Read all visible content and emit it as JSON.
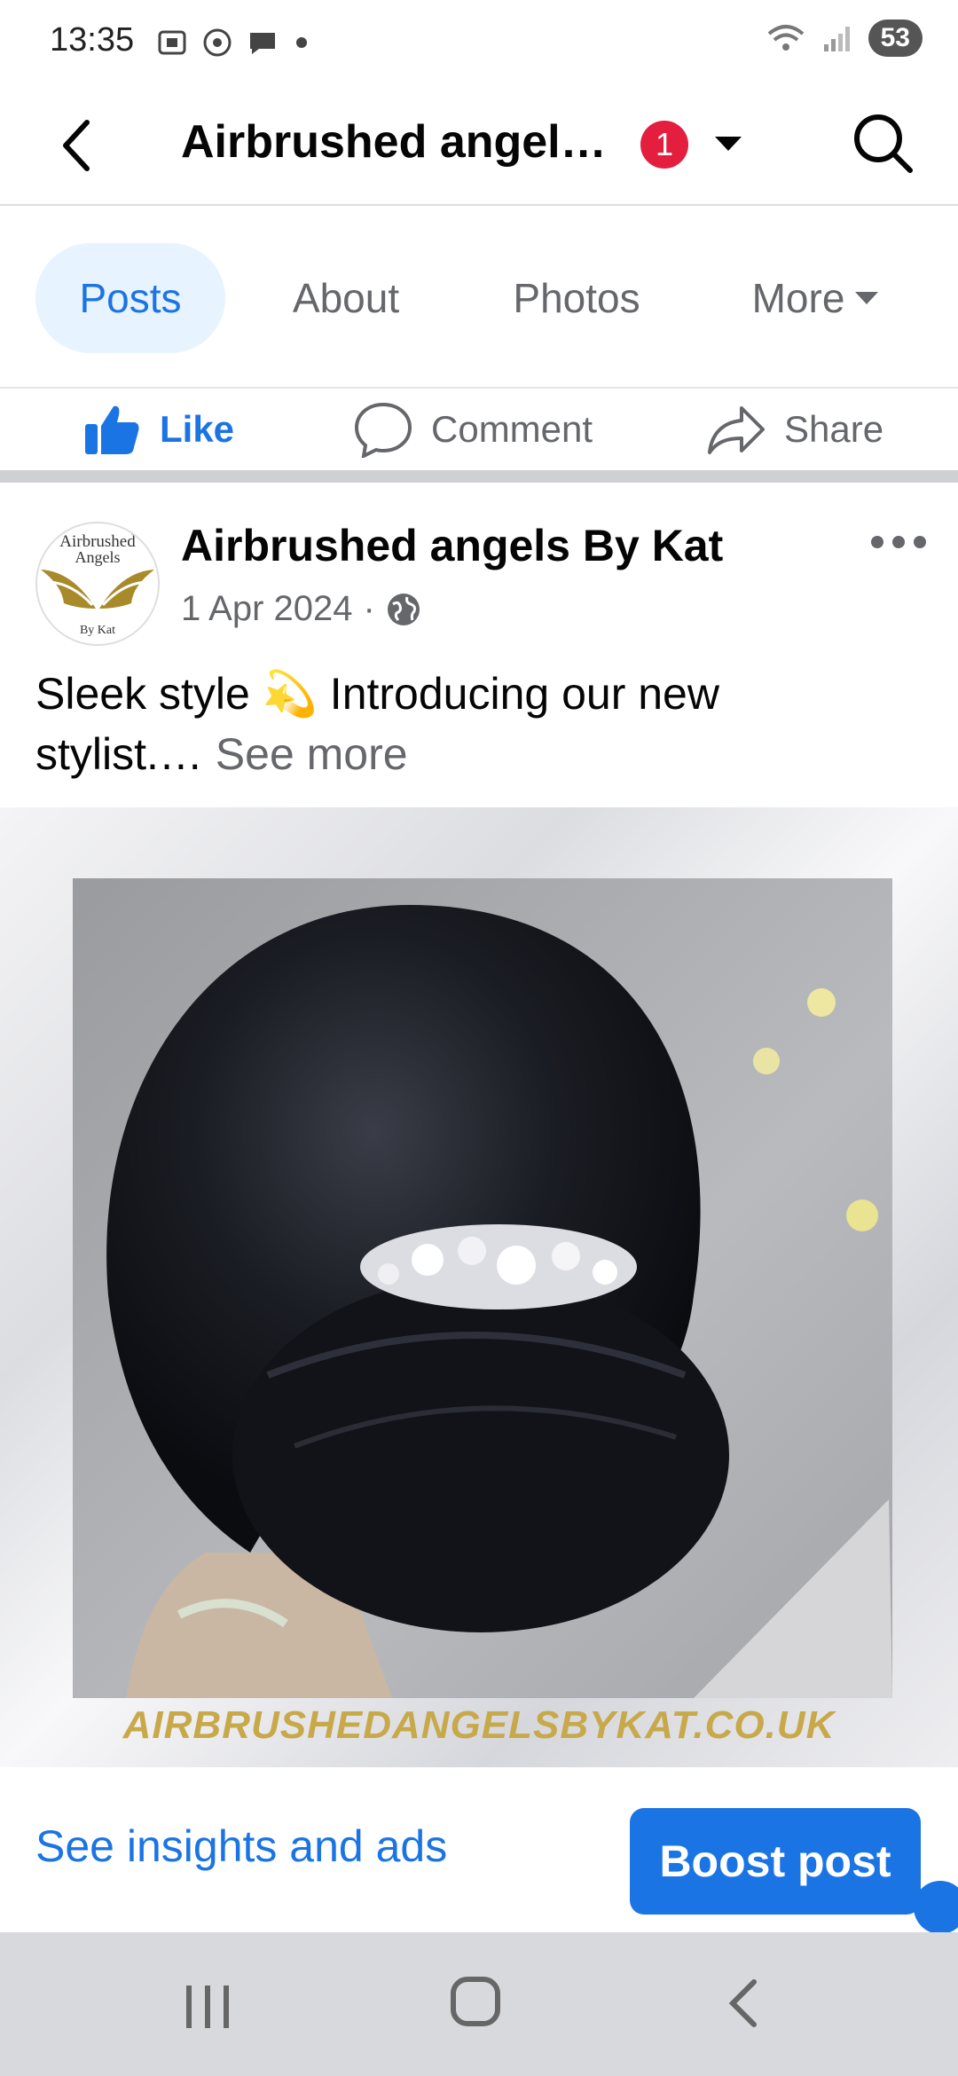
{
  "status_bar": {
    "time": "13:35",
    "battery": "53",
    "icons": [
      "screenshot-icon",
      "chrome-icon",
      "chat-icon",
      "dot-icon",
      "wifi-icon",
      "signal-icon"
    ]
  },
  "header": {
    "title": "Airbrushed angel…",
    "badge_count": "1"
  },
  "tabs": [
    {
      "label": "Posts",
      "active": true
    },
    {
      "label": "About",
      "active": false
    },
    {
      "label": "Photos",
      "active": false
    },
    {
      "label": "More",
      "active": false
    }
  ],
  "actions": {
    "like": "Like",
    "comment": "Comment",
    "share": "Share"
  },
  "post": {
    "avatar_text_top": "Airbrushed",
    "avatar_text_mid": "Angels",
    "avatar_text_bottom": "By Kat",
    "author": "Airbrushed angels By Kat",
    "date": "1 Apr 2024",
    "separator": "·",
    "text_line1": "Sleek style 💫 Introducing our new",
    "text_line2": "stylist.…",
    "see_more": " See more",
    "image_caption": "AIRBRUSHEDANGELSBYKAT.CO.UK"
  },
  "footer": {
    "insights": "See insights and ads",
    "boost": "Boost post"
  },
  "colors": {
    "accent": "#1b74e4",
    "badge": "#e41e3f",
    "gold": "#c8a94a",
    "secondary_text": "#65676b"
  }
}
